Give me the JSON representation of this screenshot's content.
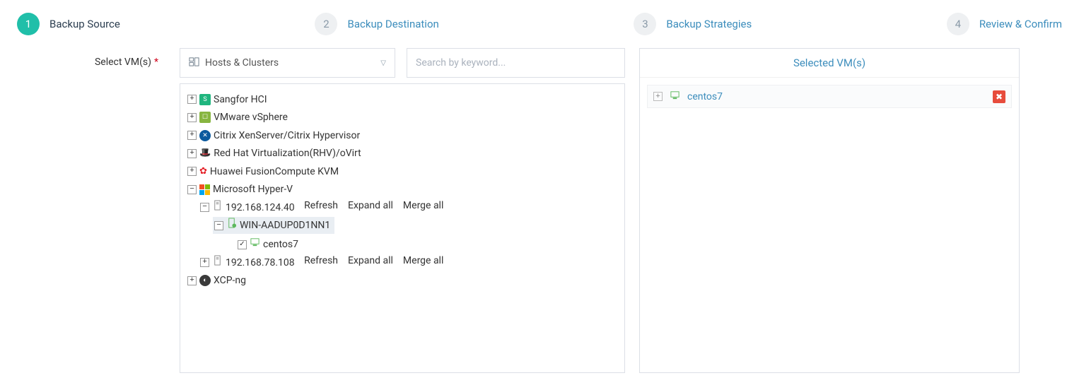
{
  "wizard": {
    "steps": [
      {
        "num": "1",
        "label": "Backup Source",
        "active": true
      },
      {
        "num": "2",
        "label": "Backup Destination",
        "active": false
      },
      {
        "num": "3",
        "label": "Backup Strategies",
        "active": false
      },
      {
        "num": "4",
        "label": "Review & Confirm",
        "active": false
      }
    ]
  },
  "form": {
    "select_vms_label": "Select VM(s)",
    "view_selector": "Hosts & Clusters",
    "search_placeholder": "Search by keyword..."
  },
  "actions": {
    "refresh": "Refresh",
    "expand_all": "Expand all",
    "merge_all": "Merge all"
  },
  "tree": {
    "sangfor": "Sangfor HCI",
    "vmware": "VMware vSphere",
    "citrix": "Citrix XenServer/Citrix Hypervisor",
    "redhat": "Red Hat Virtualization(RHV)/oVirt",
    "huawei": "Huawei FusionCompute KVM",
    "hyperv": "Microsoft Hyper-V",
    "xcp": "XCP-ng",
    "host1": "192.168.124.40",
    "host1_node": "WIN-AADUP0D1NN1",
    "host1_vm": "centos7",
    "host2": "192.168.78.108"
  },
  "selected": {
    "header": "Selected VM(s)",
    "items": [
      {
        "name": "centos7"
      }
    ]
  }
}
